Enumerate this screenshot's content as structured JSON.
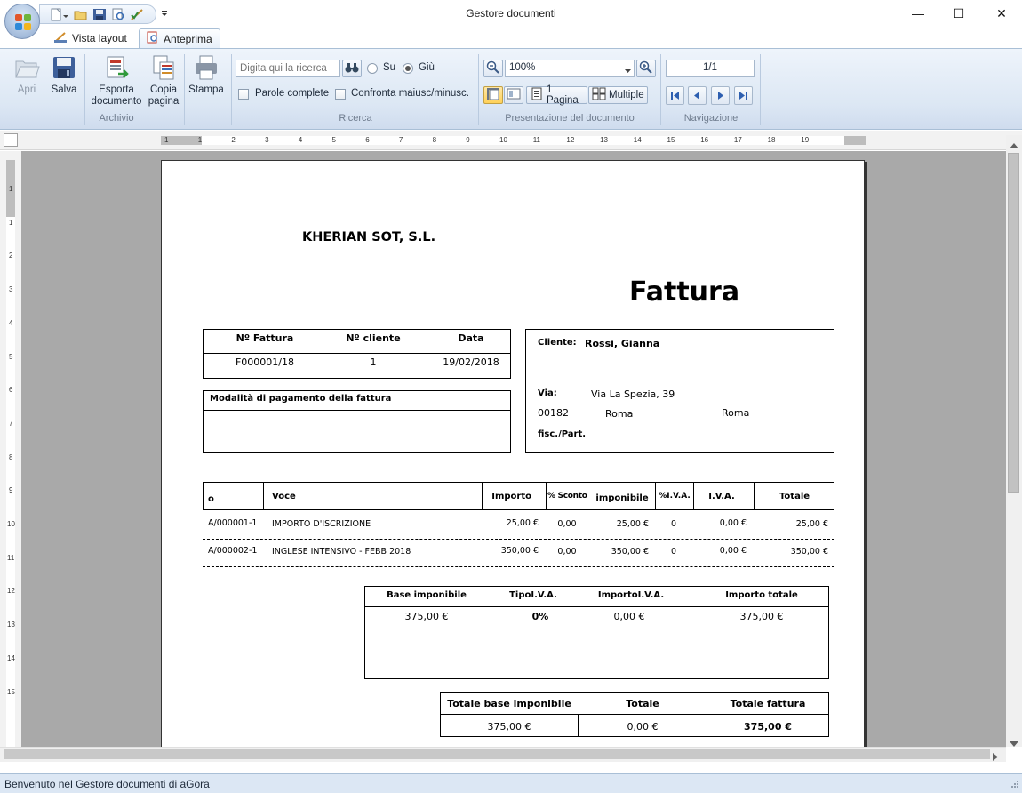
{
  "window": {
    "title": "Gestore documenti",
    "minimize": "—",
    "maximize": "☐",
    "close": "✕"
  },
  "ribbon": {
    "tabs": [
      {
        "label": "Vista layout",
        "icon": "layout-icon",
        "active": false
      },
      {
        "label": "Anteprima",
        "icon": "preview-icon",
        "active": true
      }
    ],
    "archivio": {
      "group_label": "Archivio",
      "apri": "Apri",
      "salva": "Salva",
      "esporta_line1": "Esporta",
      "esporta_line2": "documento",
      "copia_line1": "Copia",
      "copia_line2": "pagina",
      "stampa": "Stampa"
    },
    "ricerca": {
      "group_label": "Ricerca",
      "search_placeholder": "Digita qui la ricerca",
      "up_label": "Su",
      "down_label": "Giù",
      "down_selected": true,
      "whole_words": "Parole complete",
      "match_case": "Confronta maiusc/minusc."
    },
    "presentazione": {
      "group_label": "Presentazione del documento",
      "zoom": "100%",
      "one_page": "1 Pagina",
      "multiple": "Multiple"
    },
    "navigazione": {
      "group_label": "Navigazione",
      "page_indicator": "1/1"
    }
  },
  "ruler": {
    "h_ticks": [
      "1",
      "1",
      "2",
      "3",
      "4",
      "5",
      "6",
      "7",
      "8",
      "9",
      "10",
      "11",
      "12",
      "13",
      "14",
      "15",
      "16",
      "17",
      "18",
      "19"
    ],
    "v_ticks": [
      "1",
      "1",
      "2",
      "3",
      "4",
      "5",
      "6",
      "7",
      "8",
      "9",
      "10",
      "11",
      "12",
      "13",
      "14",
      "15"
    ]
  },
  "invoice": {
    "company": "KHERIAN SOT, S.L.",
    "doc_title": "Fattura",
    "meta_headers": [
      "Nº Fattura",
      "Nº cliente",
      "Data"
    ],
    "meta_values": [
      "F000001/18",
      "1",
      "19/02/2018"
    ],
    "payment_label": "Modalità di pagamento della fattura",
    "client_label": "Cliente:",
    "client_name": "Rossi, Gianna",
    "via_label": "Via:",
    "via_value": "Via La Spezia, 39",
    "cap": "00182",
    "city": "Roma",
    "province": "Roma",
    "fisc_label": "fisc./Part.",
    "lines_headers": [
      "o",
      "Voce",
      "Importo",
      "% Sconto",
      "imponibile",
      "%I.V.A.",
      "I.V.A.",
      "Totale"
    ],
    "lines": [
      [
        "A/000001-1",
        "IMPORTO D'ISCRIZIONE",
        "25,00 €",
        "0,00",
        "25,00 €",
        "0",
        "0,00 €",
        "25,00 €"
      ],
      [
        "A/000002-1",
        "INGLESE INTENSIVO - FEBB 2018",
        "350,00 €",
        "0,00",
        "350,00 €",
        "0",
        "0,00 €",
        "350,00 €"
      ]
    ],
    "tax_headers": [
      "Base imponibile",
      "TipoI.V.A.",
      "ImportoI.V.A.",
      "Importo totale"
    ],
    "tax_values": [
      "375,00 €",
      "0%",
      "0,00 €",
      "375,00 €"
    ],
    "totals_headers": [
      "Totale base imponibile",
      "Totale",
      "Totale fattura"
    ],
    "totals_values": [
      "375,00 €",
      "0,00 €",
      "375,00 €"
    ]
  },
  "status": "Benvenuto nel Gestore documenti di aGora"
}
